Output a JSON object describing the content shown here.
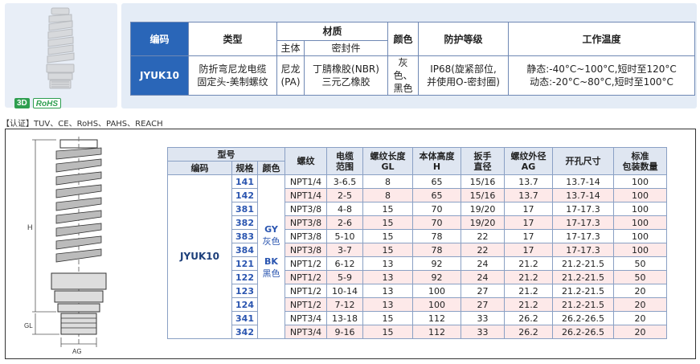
{
  "badges": {
    "three_d": "3D",
    "rohs": "RoHS"
  },
  "summary": {
    "headers": {
      "code": "编码",
      "type": "类型",
      "material": "材质",
      "material_body": "主体",
      "material_seal": "密封件",
      "color": "颜色",
      "protection": "防护等级",
      "temperature": "工作温度"
    },
    "row": {
      "code": "JYUK10",
      "type_line1": "防折弯尼龙电缆",
      "type_line2": "固定头-美制螺纹",
      "body_line1": "尼龙",
      "body_line2": "(PA)",
      "seal_line1": "丁腈橡胶(NBR)",
      "seal_line2": "三元乙橡胶",
      "color_line1": "灰色、",
      "color_line2": "黑色",
      "protection_line1": "IP68(旋紧部位,",
      "protection_line2": "并使用O-密封圈)",
      "temp_line1": "静态:-40°C~100°C,短时至120°C",
      "temp_line2": "动态:-20°C~80°C,短时至100°C"
    }
  },
  "certification": "【认证】TUV、CE、RoHS、PAHS、REACH",
  "drawing_labels": {
    "h": "H",
    "gl": "GL",
    "ag": "AG"
  },
  "spec": {
    "headers": {
      "model": "型号",
      "code": "编码",
      "spec": "规格",
      "color": "颜色",
      "thread": "螺纹",
      "cable_line1": "电缆",
      "cable_line2": "范围",
      "gl_line1": "螺纹长度",
      "gl_line2": "GL",
      "h_line1": "本体高度",
      "h_line2": "H",
      "wrench_line1": "扳手",
      "wrench_line2": "直径",
      "ag_line1": "螺纹外径",
      "ag_line2": "AG",
      "hole": "开孔尺寸",
      "pack_line1": "标准",
      "pack_line2": "包装数量"
    },
    "group_code": "JYUK10",
    "color_gy_code": "GY",
    "color_gy_name": "灰色",
    "color_bk_code": "BK",
    "color_bk_name": "黑色",
    "rows": [
      {
        "spec": "141",
        "thread": "NPT1/4",
        "cable": "3-6.5",
        "gl": "8",
        "h": "65",
        "wrench": "15/16",
        "ag": "13.7",
        "hole": "13.7-14",
        "pack": "100"
      },
      {
        "spec": "142",
        "thread": "NPT1/4",
        "cable": "2-5",
        "gl": "8",
        "h": "65",
        "wrench": "15/16",
        "ag": "13.7",
        "hole": "13.7-14",
        "pack": "100"
      },
      {
        "spec": "381",
        "thread": "NPT3/8",
        "cable": "4-8",
        "gl": "15",
        "h": "70",
        "wrench": "19/20",
        "ag": "17",
        "hole": "17-17.3",
        "pack": "100"
      },
      {
        "spec": "382",
        "thread": "NPT3/8",
        "cable": "2-6",
        "gl": "15",
        "h": "70",
        "wrench": "19/20",
        "ag": "17",
        "hole": "17-17.3",
        "pack": "100"
      },
      {
        "spec": "383",
        "thread": "NPT3/8",
        "cable": "5-10",
        "gl": "15",
        "h": "78",
        "wrench": "22",
        "ag": "17",
        "hole": "17-17.3",
        "pack": "100"
      },
      {
        "spec": "384",
        "thread": "NPT3/8",
        "cable": "3-7",
        "gl": "15",
        "h": "78",
        "wrench": "22",
        "ag": "17",
        "hole": "17-17.3",
        "pack": "100"
      },
      {
        "spec": "121",
        "thread": "NPT1/2",
        "cable": "6-12",
        "gl": "13",
        "h": "92",
        "wrench": "24",
        "ag": "21.2",
        "hole": "21.2-21.5",
        "pack": "50"
      },
      {
        "spec": "122",
        "thread": "NPT1/2",
        "cable": "5-9",
        "gl": "13",
        "h": "92",
        "wrench": "24",
        "ag": "21.2",
        "hole": "21.2-21.5",
        "pack": "50"
      },
      {
        "spec": "123",
        "thread": "NPT1/2",
        "cable": "10-14",
        "gl": "13",
        "h": "100",
        "wrench": "27",
        "ag": "21.2",
        "hole": "21.2-21.5",
        "pack": "20"
      },
      {
        "spec": "124",
        "thread": "NPT1/2",
        "cable": "7-12",
        "gl": "13",
        "h": "100",
        "wrench": "27",
        "ag": "21.2",
        "hole": "21.2-21.5",
        "pack": "20"
      },
      {
        "spec": "341",
        "thread": "NPT3/4",
        "cable": "13-18",
        "gl": "15",
        "h": "112",
        "wrench": "33",
        "ag": "26.2",
        "hole": "26.2-26.5",
        "pack": "20"
      },
      {
        "spec": "342",
        "thread": "NPT3/4",
        "cable": "9-16",
        "gl": "15",
        "h": "112",
        "wrench": "33",
        "ag": "26.2",
        "hole": "26.2-26.5",
        "pack": "20"
      }
    ]
  }
}
